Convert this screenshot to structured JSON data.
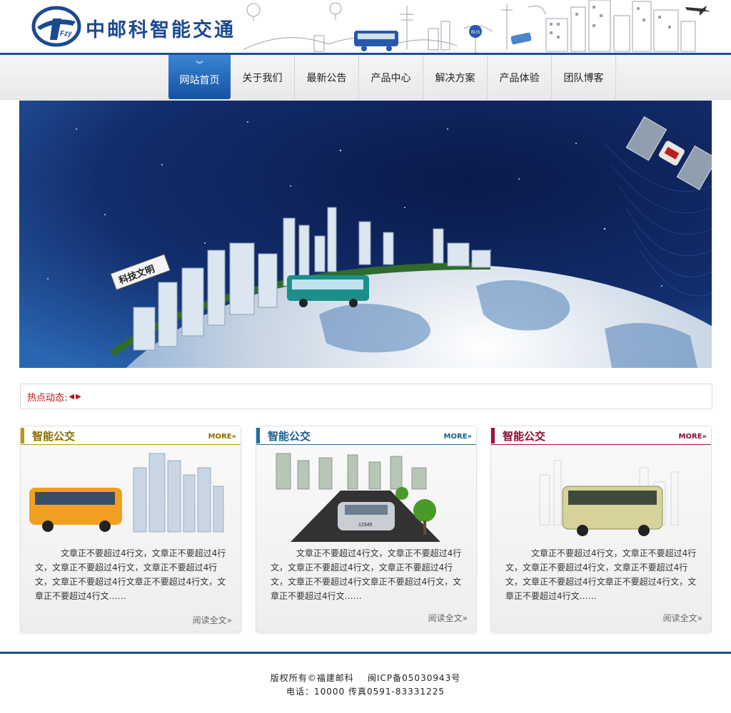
{
  "header": {
    "logo_text": "中邮科智能交通",
    "logo_initials": "Fzy"
  },
  "nav": {
    "items": [
      {
        "label": "网站首页",
        "active": true
      },
      {
        "label": "关于我们",
        "active": false
      },
      {
        "label": "最新公告",
        "active": false
      },
      {
        "label": "产品中心",
        "active": false
      },
      {
        "label": "解决方案",
        "active": false
      },
      {
        "label": "产品体验",
        "active": false
      },
      {
        "label": "团队博客",
        "active": false
      }
    ],
    "active_icon": "double-chevron-down-icon"
  },
  "banner": {
    "sign_text": "科技文明",
    "bus_icon": "bus-icon",
    "satellite_icon": "satellite-icon"
  },
  "hot": {
    "label": "热点动态:",
    "prev_icon": "triangle-left-icon",
    "next_icon": "triangle-right-icon"
  },
  "cards": [
    {
      "title": "智能公交",
      "more": "MORE",
      "accent": "#b8960f",
      "body": "文章正不要超过4行文，文章正不要超过4行文，文章正不要超过4行文，文章正不要超过4行文，文章正不要超过4行文章正不要超过4行文，文章正不要超过4行文……",
      "read_more": "阅读全文"
    },
    {
      "title": "智能公交",
      "more": "MORE",
      "accent": "#1e6fa6",
      "body": "文章正不要超过4行文，文章正不要超过4行文，文章正不要超过4行文，文章正不要超过4行文，文章正不要超过4行文章正不要超过4行文，文章正不要超过4行文……",
      "read_more": "阅读全文"
    },
    {
      "title": "智能公交",
      "more": "MORE",
      "accent": "#a0103a",
      "body": "文章正不要超过4行文，文章正不要超过4行文，文章正不要超过4行文，文章正不要超过4行文，文章正不要超过4行文章正不要超过4行文，文章正不要超过4行文……",
      "read_more": "阅读全文"
    }
  ],
  "footer": {
    "line1": "版权所有©福建邮科    闽ICP备05030943号",
    "line2": "电话：10000 传真0591-83331225"
  },
  "colors": {
    "brand_blue": "#1c4f93",
    "nav_active": "#1a5aa8",
    "hot_red": "#c01010"
  }
}
